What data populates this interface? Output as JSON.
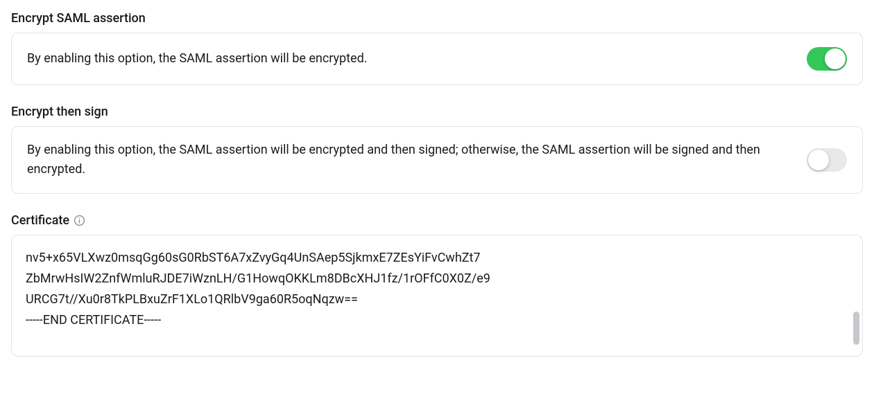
{
  "sections": {
    "encrypt_assertion": {
      "title": "Encrypt SAML assertion",
      "description": "By enabling this option, the SAML assertion will be encrypted.",
      "enabled": true
    },
    "encrypt_then_sign": {
      "title": "Encrypt then sign",
      "description": "By enabling this option, the SAML assertion will be encrypted and then signed; otherwise, the SAML assertion will be signed and then encrypted.",
      "enabled": false
    },
    "certificate": {
      "title": "Certificate",
      "value": "nv5+x65VLXwz0msqGg60sG0RbST6A7xZvyGq4UnSAep5SjkmxE7ZEsYiFvCwhZt7\nZbMrwHsIW2ZnfWmluRJDE7iWznLH/G1HowqOKKLm8DBcXHJ1fz/1rOFfC0X0Z/e9\nURCG7t//Xu0r8TkPLBxuZrF1XLo1QRlbV9ga60R5oqNqzw==\n-----END CERTIFICATE-----"
    }
  }
}
